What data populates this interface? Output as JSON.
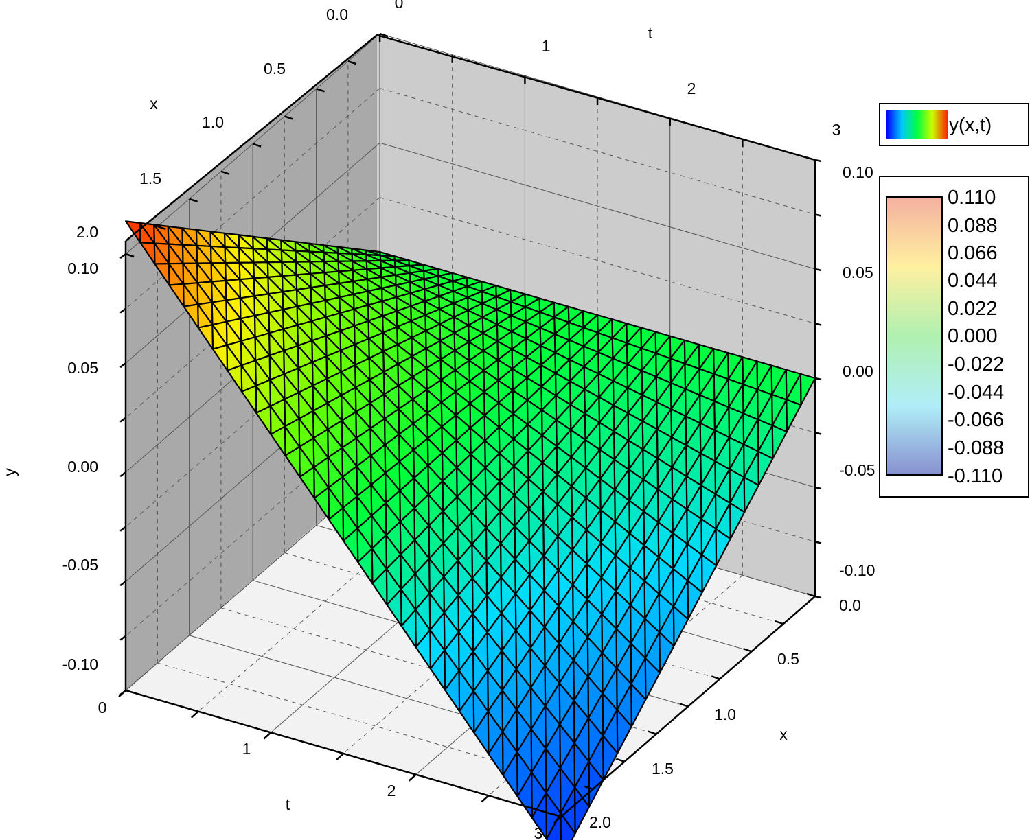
{
  "chart_data": {
    "type": "surface3d",
    "title": "",
    "series": [
      {
        "name": "y(x,t)"
      }
    ],
    "axes": {
      "t": {
        "label": "t",
        "range": [
          0,
          3
        ],
        "ticks": [
          "0",
          "1",
          "2",
          "3"
        ]
      },
      "x": {
        "label": "x",
        "range": [
          0,
          2
        ],
        "ticks": [
          "0.0",
          "0.5",
          "1.0",
          "1.5",
          "2.0"
        ]
      },
      "y": {
        "label": "y",
        "range": [
          -0.1,
          0.1
        ],
        "ticks_left": [
          "0.10",
          "0.05",
          "0.00",
          "-0.05",
          "-0.10"
        ],
        "ticks_right": [
          "0.10",
          "0.05",
          "0.00",
          "-0.05",
          "-0.10"
        ]
      }
    },
    "grid": true,
    "surface_corner_values": {
      "t0_x0": 0.0,
      "t3_x0": 0.0,
      "t0_x2": 0.115,
      "t3_x2": -0.12
    },
    "colorbar": {
      "labels": [
        "0.110",
        "0.088",
        "0.066",
        "0.044",
        "0.022",
        "0.000",
        "-0.022",
        "-0.044",
        "-0.066",
        "-0.088",
        "-0.110"
      ],
      "range": [
        -0.11,
        0.11
      ]
    },
    "legend_placement": "right"
  }
}
